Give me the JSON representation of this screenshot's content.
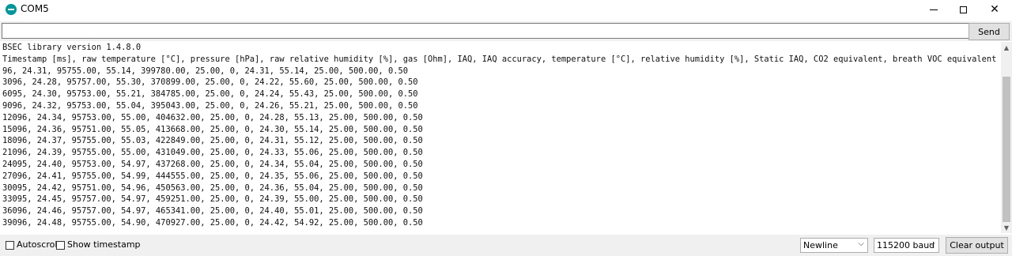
{
  "window": {
    "title": "COM5",
    "minimize_symbol": "",
    "maximize_symbol": "",
    "close_symbol": "✕"
  },
  "input": {
    "value": "",
    "send_label": "Send"
  },
  "console": {
    "lines": [
      "BSEC library version 1.4.8.0",
      "Timestamp [ms], raw temperature [°C], pressure [hPa], raw relative humidity [%], gas [Ohm], IAQ, IAQ accuracy, temperature [°C], relative humidity [%], Static IAQ, CO2 equivalent, breath VOC equivalent",
      "96, 24.31, 95755.00, 55.14, 399780.00, 25.00, 0, 24.31, 55.14, 25.00, 500.00, 0.50",
      "3096, 24.28, 95757.00, 55.30, 370899.00, 25.00, 0, 24.22, 55.60, 25.00, 500.00, 0.50",
      "6095, 24.30, 95753.00, 55.21, 384785.00, 25.00, 0, 24.24, 55.43, 25.00, 500.00, 0.50",
      "9096, 24.32, 95753.00, 55.04, 395043.00, 25.00, 0, 24.26, 55.21, 25.00, 500.00, 0.50",
      "12096, 24.34, 95753.00, 55.00, 404632.00, 25.00, 0, 24.28, 55.13, 25.00, 500.00, 0.50",
      "15096, 24.36, 95751.00, 55.05, 413668.00, 25.00, 0, 24.30, 55.14, 25.00, 500.00, 0.50",
      "18096, 24.37, 95755.00, 55.03, 422849.00, 25.00, 0, 24.31, 55.12, 25.00, 500.00, 0.50",
      "21096, 24.39, 95755.00, 55.00, 431049.00, 25.00, 0, 24.33, 55.06, 25.00, 500.00, 0.50",
      "24095, 24.40, 95753.00, 54.97, 437268.00, 25.00, 0, 24.34, 55.04, 25.00, 500.00, 0.50",
      "27096, 24.41, 95755.00, 54.99, 444555.00, 25.00, 0, 24.35, 55.06, 25.00, 500.00, 0.50",
      "30095, 24.42, 95751.00, 54.96, 450563.00, 25.00, 0, 24.36, 55.04, 25.00, 500.00, 0.50",
      "33095, 24.45, 95757.00, 54.97, 459251.00, 25.00, 0, 24.39, 55.00, 25.00, 500.00, 0.50",
      "36096, 24.46, 95757.00, 54.97, 465341.00, 25.00, 0, 24.40, 55.01, 25.00, 500.00, 0.50",
      "39096, 24.48, 95755.00, 54.90, 470927.00, 25.00, 0, 24.42, 54.92, 25.00, 500.00, 0.50"
    ]
  },
  "scrollbar": {
    "up_symbol": "▲",
    "down_symbol": "▼"
  },
  "footer": {
    "autoscroll_label": "Autoscroll",
    "show_timestamp_label": "Show timestamp",
    "line_ending": "Newline",
    "baud_rate": "115200 baud",
    "clear_label": "Clear output",
    "chevron_symbol": "⌵"
  }
}
